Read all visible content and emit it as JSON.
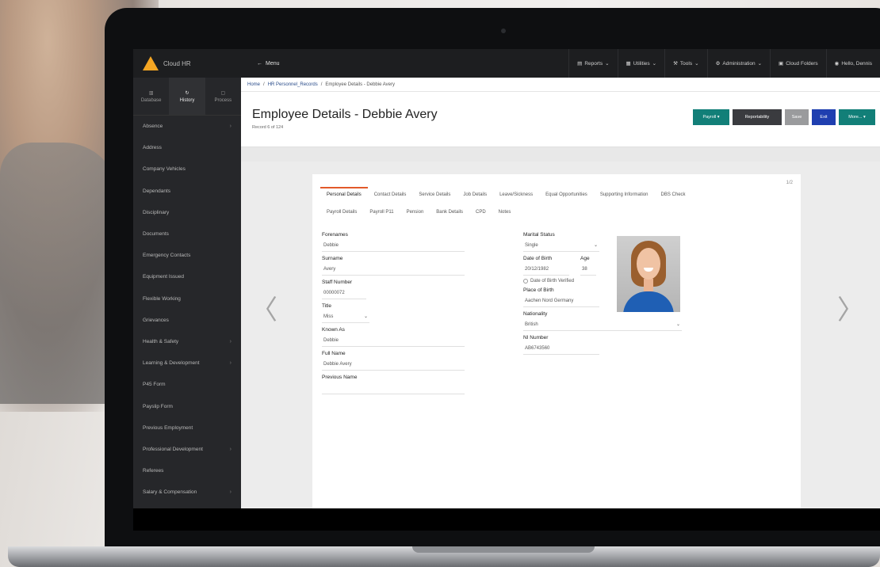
{
  "app": {
    "logo_text": "Cloud HR",
    "menu_label": "Menu"
  },
  "topnav": [
    {
      "label": "Reports",
      "icon": "chart-icon",
      "has_dropdown": true
    },
    {
      "label": "Utilities",
      "icon": "grid-icon",
      "has_dropdown": true
    },
    {
      "label": "Tools",
      "icon": "tools-icon",
      "has_dropdown": true
    },
    {
      "label": "Administration",
      "icon": "admin-icon",
      "has_dropdown": true
    },
    {
      "label": "Cloud Folders",
      "icon": "folder-icon",
      "has_dropdown": false
    },
    {
      "label": "Hello, Dennis",
      "icon": "user-icon",
      "has_dropdown": false
    }
  ],
  "sidebar": {
    "tabs": [
      {
        "label": "Database",
        "icon": "database-icon",
        "active": false
      },
      {
        "label": "History",
        "icon": "history-icon",
        "active": true
      },
      {
        "label": "Process",
        "icon": "process-icon",
        "active": false
      }
    ],
    "items": [
      {
        "label": "Absence",
        "chevron": true
      },
      {
        "label": "Address",
        "chevron": false
      },
      {
        "label": "Company Vehicles",
        "chevron": false
      },
      {
        "label": "Dependants",
        "chevron": false
      },
      {
        "label": "Disciplinary",
        "chevron": false
      },
      {
        "label": "Documents",
        "chevron": false
      },
      {
        "label": "Emergency Contacts",
        "chevron": false
      },
      {
        "label": "Equipment Issued",
        "chevron": false
      },
      {
        "label": "Flexible Working",
        "chevron": false
      },
      {
        "label": "Grievances",
        "chevron": false
      },
      {
        "label": "Health & Safety",
        "chevron": true
      },
      {
        "label": "Learning & Development",
        "chevron": true
      },
      {
        "label": "P45 Form",
        "chevron": false
      },
      {
        "label": "Payslip Form",
        "chevron": false
      },
      {
        "label": "Previous Employment",
        "chevron": false
      },
      {
        "label": "Professional Development",
        "chevron": true
      },
      {
        "label": "Referees",
        "chevron": false
      },
      {
        "label": "Salary & Compensation",
        "chevron": true
      }
    ]
  },
  "breadcrumb": {
    "home": "Home",
    "section": "HR Personnel_Records",
    "current": "Employee Details - Debbie Avery"
  },
  "header": {
    "title": "Employee Details - Debbie Avery",
    "subtitle": "Record 6 of 124"
  },
  "actions": {
    "payroll": "Payroll ▾",
    "reportability": "Reportability",
    "save": "Save",
    "exit": "Exit",
    "more": "More... ▾"
  },
  "card": {
    "page_indicator": "1/2",
    "tabs_row1": [
      "Personal Details",
      "Contact Details",
      "Service Details",
      "Job Details",
      "Leave/Sickness",
      "Equal Opportunities",
      "Supporting Information",
      "DBS Check"
    ],
    "tabs_row2": [
      "Payroll Details",
      "Payroll P11",
      "Pension",
      "Bank Details",
      "CPD",
      "Notes"
    ],
    "active_tab": "Personal Details"
  },
  "form": {
    "forenames": {
      "label": "Forenames",
      "value": "Debbie"
    },
    "surname": {
      "label": "Surname",
      "value": "Avery"
    },
    "staff_number": {
      "label": "Staff Number",
      "value": "00000072"
    },
    "title": {
      "label": "Title",
      "value": "Miss"
    },
    "known_as": {
      "label": "Known As",
      "value": "Debbie"
    },
    "full_name": {
      "label": "Full Name",
      "value": "Debbie Avery"
    },
    "previous_name": {
      "label": "Previous Name",
      "value": ""
    },
    "marital_status": {
      "label": "Marital Status",
      "value": "Single"
    },
    "date_of_birth": {
      "label": "Date of Birth",
      "value": "20/12/1982"
    },
    "age": {
      "label": "Age",
      "value": "38"
    },
    "dob_verified": {
      "label": "Date of Birth Verified",
      "checked": false
    },
    "place_of_birth": {
      "label": "Place of Birth",
      "value": "Aachen Nord Germany"
    },
    "nationality": {
      "label": "Nationality",
      "value": "British"
    },
    "ni_number": {
      "label": "NI Number",
      "value": "AB6743560"
    }
  }
}
